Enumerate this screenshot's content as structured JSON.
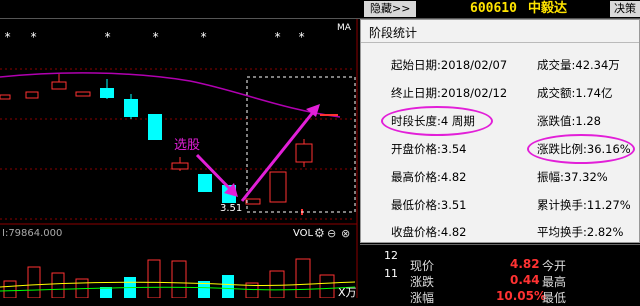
{
  "topbar": {
    "hide_label": "隐藏>>",
    "stock_code": "600610",
    "stock_name": "中毅达",
    "decide_tab": "决策"
  },
  "chart": {
    "ma_label": "MA",
    "annotation_pick": "选股",
    "price_label": "3.51",
    "volume_label": "I:79864.000",
    "vol_label": "VOL",
    "x_label": "X万",
    "colors": {
      "up": "#ff3232",
      "down": "#00ffff",
      "ma": "#b000b0",
      "arrow": "#e21fd8"
    }
  },
  "panel": {
    "title": "阶段统计",
    "left_rows": [
      {
        "label": "起始日期:",
        "value": "2018/02/07"
      },
      {
        "label": "终止日期:",
        "value": "2018/02/12"
      },
      {
        "label": "时段长度:",
        "value": "4 周期"
      },
      {
        "label": "开盘价格:",
        "value": "3.54"
      },
      {
        "label": "最高价格:",
        "value": "4.82"
      },
      {
        "label": "最低价格:",
        "value": "3.51"
      },
      {
        "label": "收盘价格:",
        "value": "4.82"
      }
    ],
    "right_rows": [
      {
        "label": "成交量:",
        "value": "42.34万"
      },
      {
        "label": "成交额:",
        "value": "1.74亿"
      },
      {
        "label": "涨跌值:",
        "value": "1.28"
      },
      {
        "label": "涨跌比例:",
        "value": "36.16%"
      },
      {
        "label": "振幅:",
        "value": "37.32%"
      },
      {
        "label": "累计换手:",
        "value": "11.27%"
      },
      {
        "label": "平均换手:",
        "value": "2.82%"
      }
    ]
  },
  "quote": {
    "row_nums": [
      "12",
      "11"
    ],
    "items": [
      {
        "label": "现价",
        "value": "4.82",
        "label2": "今开"
      },
      {
        "label": "涨跌",
        "value": "0.44",
        "label2": "最高"
      },
      {
        "label": "涨幅",
        "value": "10.05%",
        "label2": "最低"
      }
    ]
  }
}
